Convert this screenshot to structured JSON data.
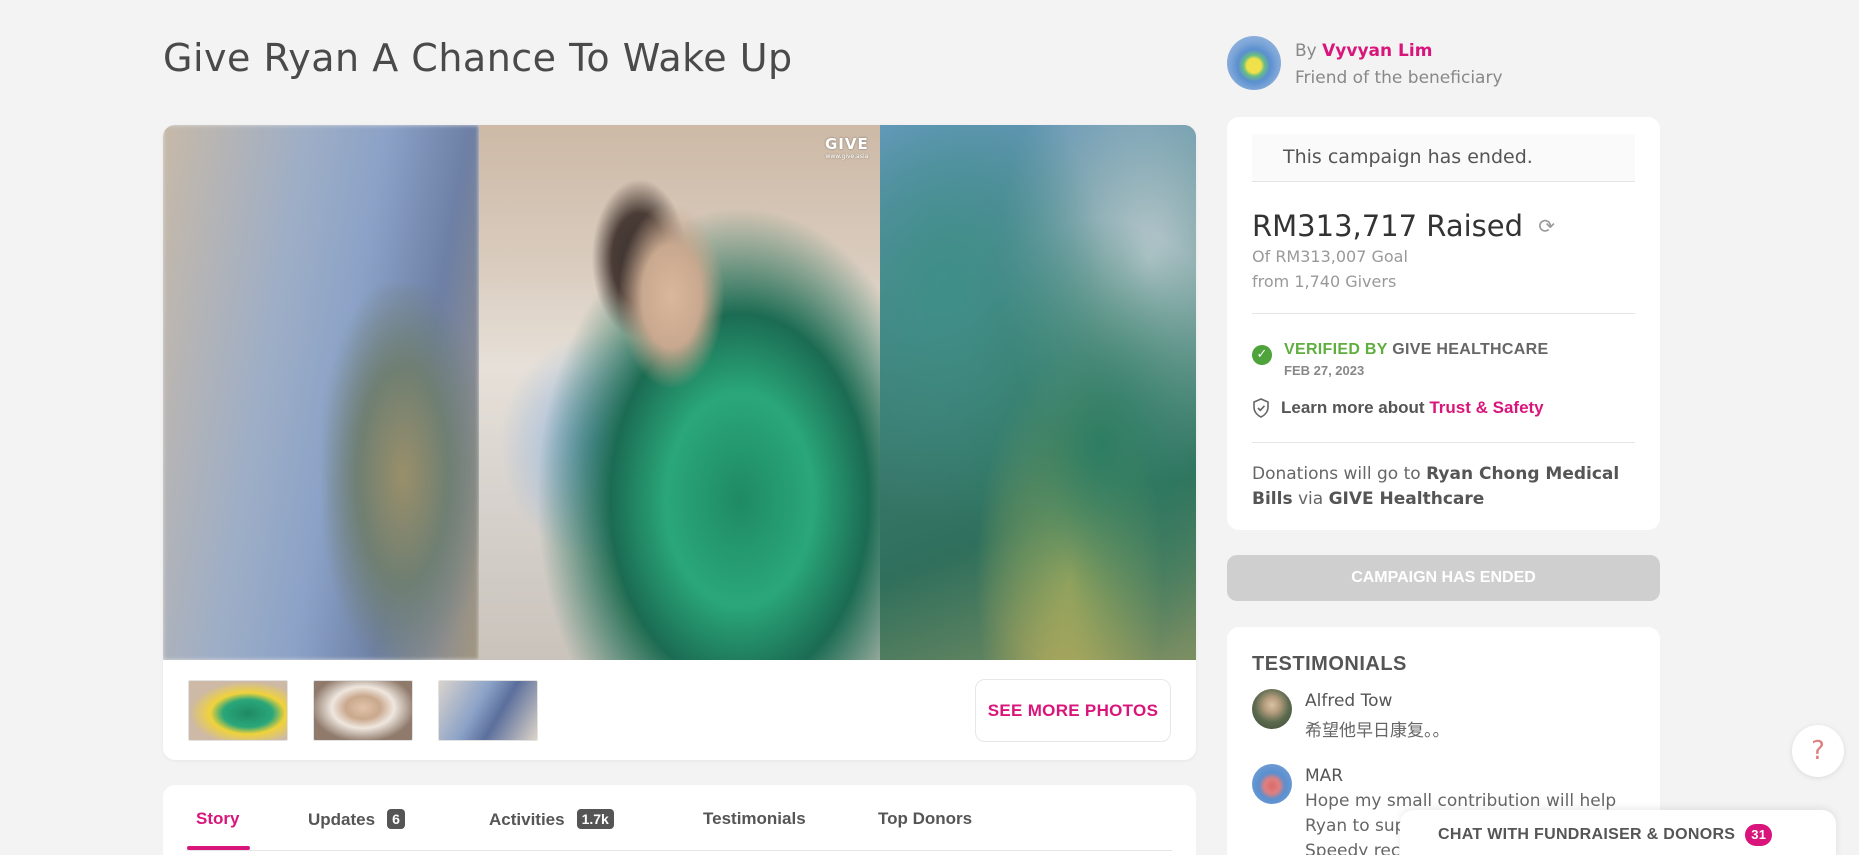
{
  "campaign": {
    "title": "Give Ryan A Chance To Wake Up"
  },
  "gallery": {
    "watermark": "GIVE",
    "watermark_small": "www.give.asia",
    "thumbnails": [
      "photo-1",
      "photo-2",
      "photo-3"
    ],
    "see_more_label": "SEE MORE PHOTOS"
  },
  "tabs": [
    {
      "label": "Story",
      "active": true
    },
    {
      "label": "Updates",
      "badge": "6"
    },
    {
      "label": "Activities",
      "badge": "1.7k"
    },
    {
      "label": "Testimonials"
    },
    {
      "label": "Top Donors"
    }
  ],
  "organizer": {
    "by": "By",
    "name": "Vyvyan Lim",
    "role": "Friend of the beneficiary"
  },
  "status": {
    "ended_text": "This campaign has ended.",
    "raised": "RM313,717 Raised",
    "goal": "Of RM313,007 Goal",
    "givers": "from 1,740 Givers",
    "verified_by": "VERIFIED BY",
    "verified_org": "GIVE HEALTHCARE",
    "verified_date": "FEB 27, 2023",
    "trust_prefix": "Learn more about",
    "trust_link": "Trust & Safety",
    "donations_prefix": "Donations will go to",
    "donations_target": "Ryan Chong Medical Bills",
    "donations_via": "via",
    "donations_org": "GIVE Healthcare"
  },
  "ended_button": "CAMPAIGN HAS ENDED",
  "testimonials": {
    "title": "TESTIMONIALS",
    "items": [
      {
        "name": "Alfred Tow",
        "lines": [
          "希望他早日康复。。"
        ]
      },
      {
        "name": "MAR",
        "lines": [
          "Hope my small contribution will help",
          "Ryan to sup",
          "Speedy reco"
        ]
      }
    ]
  },
  "chat": {
    "label": "CHAT WITH FUNDRAISER & DONORS",
    "count": "31"
  },
  "help": {
    "label": "?"
  },
  "colors": {
    "accent": "#d9157b",
    "verified": "#5fae3f",
    "disabled_button": "#cfcfcf"
  }
}
